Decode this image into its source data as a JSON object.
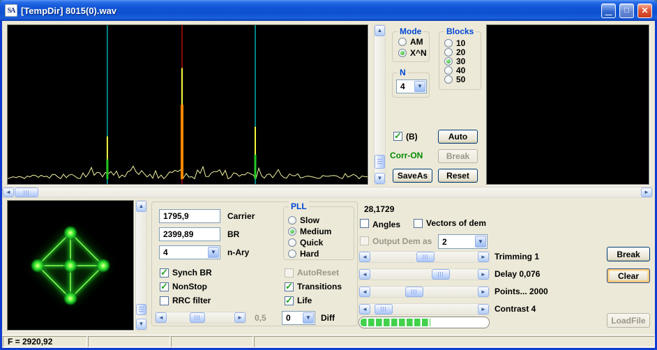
{
  "window": {
    "title": "[TempDir] 8015(0).wav",
    "icon_text": "SA"
  },
  "icons": {
    "minimize": "—",
    "maximize": "□",
    "close": "✕",
    "check": "✓",
    "combo_arrow": "▼",
    "chevron_left": "◄",
    "chevron_right": "►",
    "chevron_up": "▲",
    "chevron_down": "▼"
  },
  "spectrum": {
    "background": "#000000",
    "noise_color": "#f2f2a2",
    "markers": [
      {
        "name": "left-marker",
        "pos": 0.277,
        "color": "#00d8d8"
      },
      {
        "name": "carrier-marker",
        "pos": 0.4845,
        "color": "#dd1111"
      },
      {
        "name": "right-marker",
        "pos": 0.688,
        "color": "#00d8d8"
      }
    ],
    "peaks": [
      {
        "pos": 0.277,
        "tip_frac": 0.3,
        "mid_frac": 0.155,
        "tip_color": "#f8f840",
        "base_color": "#22cc22",
        "stroke_width": 3
      },
      {
        "pos": 0.4845,
        "tip_frac": 0.73,
        "mid_frac": 0.5,
        "tip_color": "#f8f840",
        "base_color": "#ff8800",
        "stroke_width": 4
      },
      {
        "pos": 0.688,
        "tip_frac": 0.36,
        "mid_frac": 0.185,
        "tip_color": "#f8f840",
        "base_color": "#22cc22",
        "stroke_width": 3
      }
    ]
  },
  "constellation": {
    "background": "#000000",
    "line_color": "#21d321",
    "node_color": "#eaff80"
  },
  "mode_group": {
    "title": "Mode",
    "options": [
      {
        "label": "AM",
        "selected": false
      },
      {
        "label": "X^N",
        "selected": true
      }
    ]
  },
  "n_group": {
    "title": "N",
    "value": "4"
  },
  "blocks_group": {
    "title": "Blocks",
    "options": [
      {
        "label": "10",
        "selected": false
      },
      {
        "label": "20",
        "selected": false
      },
      {
        "label": "30",
        "selected": true
      },
      {
        "label": "40",
        "selected": false
      },
      {
        "label": "50",
        "selected": false
      }
    ]
  },
  "controls": {
    "b_checkbox": {
      "label": "(B)",
      "checked": true
    },
    "auto": "Auto",
    "corr_status": "Corr-ON",
    "break": "Break",
    "saveas": "SaveAs",
    "reset": "Reset"
  },
  "demod": {
    "carrier": {
      "label": "Carrier",
      "value": "1795,9"
    },
    "br": {
      "label": "BR",
      "value": "2399,89"
    },
    "nary": {
      "label": "n-Ary",
      "value": "4"
    },
    "synch": {
      "label": "Synch BR",
      "checked": true
    },
    "nonstop": {
      "label": "NonStop",
      "checked": true
    },
    "rrc": {
      "label": "RRC filter",
      "checked": false
    },
    "rate_slider": {
      "value_label": "0,5",
      "pos": 0.45
    },
    "pll": {
      "title": "PLL",
      "options": [
        {
          "label": "Slow",
          "selected": false
        },
        {
          "label": "Medium",
          "selected": true
        },
        {
          "label": "Quick",
          "selected": false
        },
        {
          "label": "Hard",
          "selected": false
        }
      ]
    },
    "autoreset": {
      "label": "AutoReset",
      "checked": false,
      "disabled": true
    },
    "transitions": {
      "label": "Transitions",
      "checked": true
    },
    "life": {
      "label": "Life",
      "checked": true
    },
    "diff": {
      "label": "Diff",
      "value": "0"
    }
  },
  "analysis": {
    "readout": "28,1729",
    "angles": {
      "label": "Angles",
      "checked": false
    },
    "vectors": {
      "label": "Vectors of dem",
      "checked": false
    },
    "output_dem": {
      "label": "Output Dem as",
      "checked": false,
      "disabled": true,
      "value": "2"
    },
    "sliders": [
      {
        "label": "Trimming 1",
        "pos": 0.52
      },
      {
        "label": "Delay  0,076",
        "pos": 0.7
      },
      {
        "label": "Points... 2000",
        "pos": 0.4
      },
      {
        "label": "Contrast 4",
        "pos": 0.05
      }
    ],
    "progress_fraction": 0.55,
    "break": "Break",
    "clear": "Clear",
    "loadfile": "LoadFile"
  },
  "statusbar": {
    "f_readout": "F = 2920,92"
  }
}
